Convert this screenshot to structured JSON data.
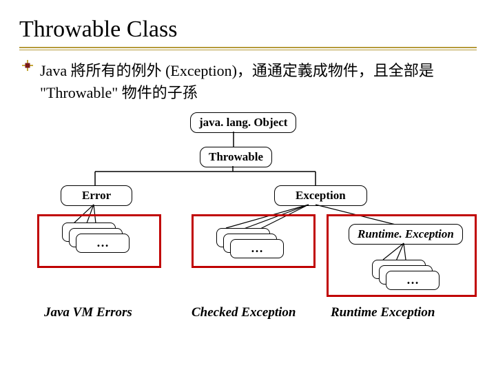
{
  "title": "Throwable Class",
  "bullet": "Java 將所有的例外 (Exception)，通通定義成物件，且全部是 \"Throwable\" 物件的子孫",
  "nodes": {
    "object": "java. lang. Object",
    "throwable": "Throwable",
    "error": "Error",
    "exception": "Exception",
    "runtime": "Runtime. Exception"
  },
  "ellipsis": "…",
  "captions": {
    "vmErrors": "Java VM Errors",
    "checked": "Checked Exception",
    "runtimeEx": "Runtime Exception"
  }
}
